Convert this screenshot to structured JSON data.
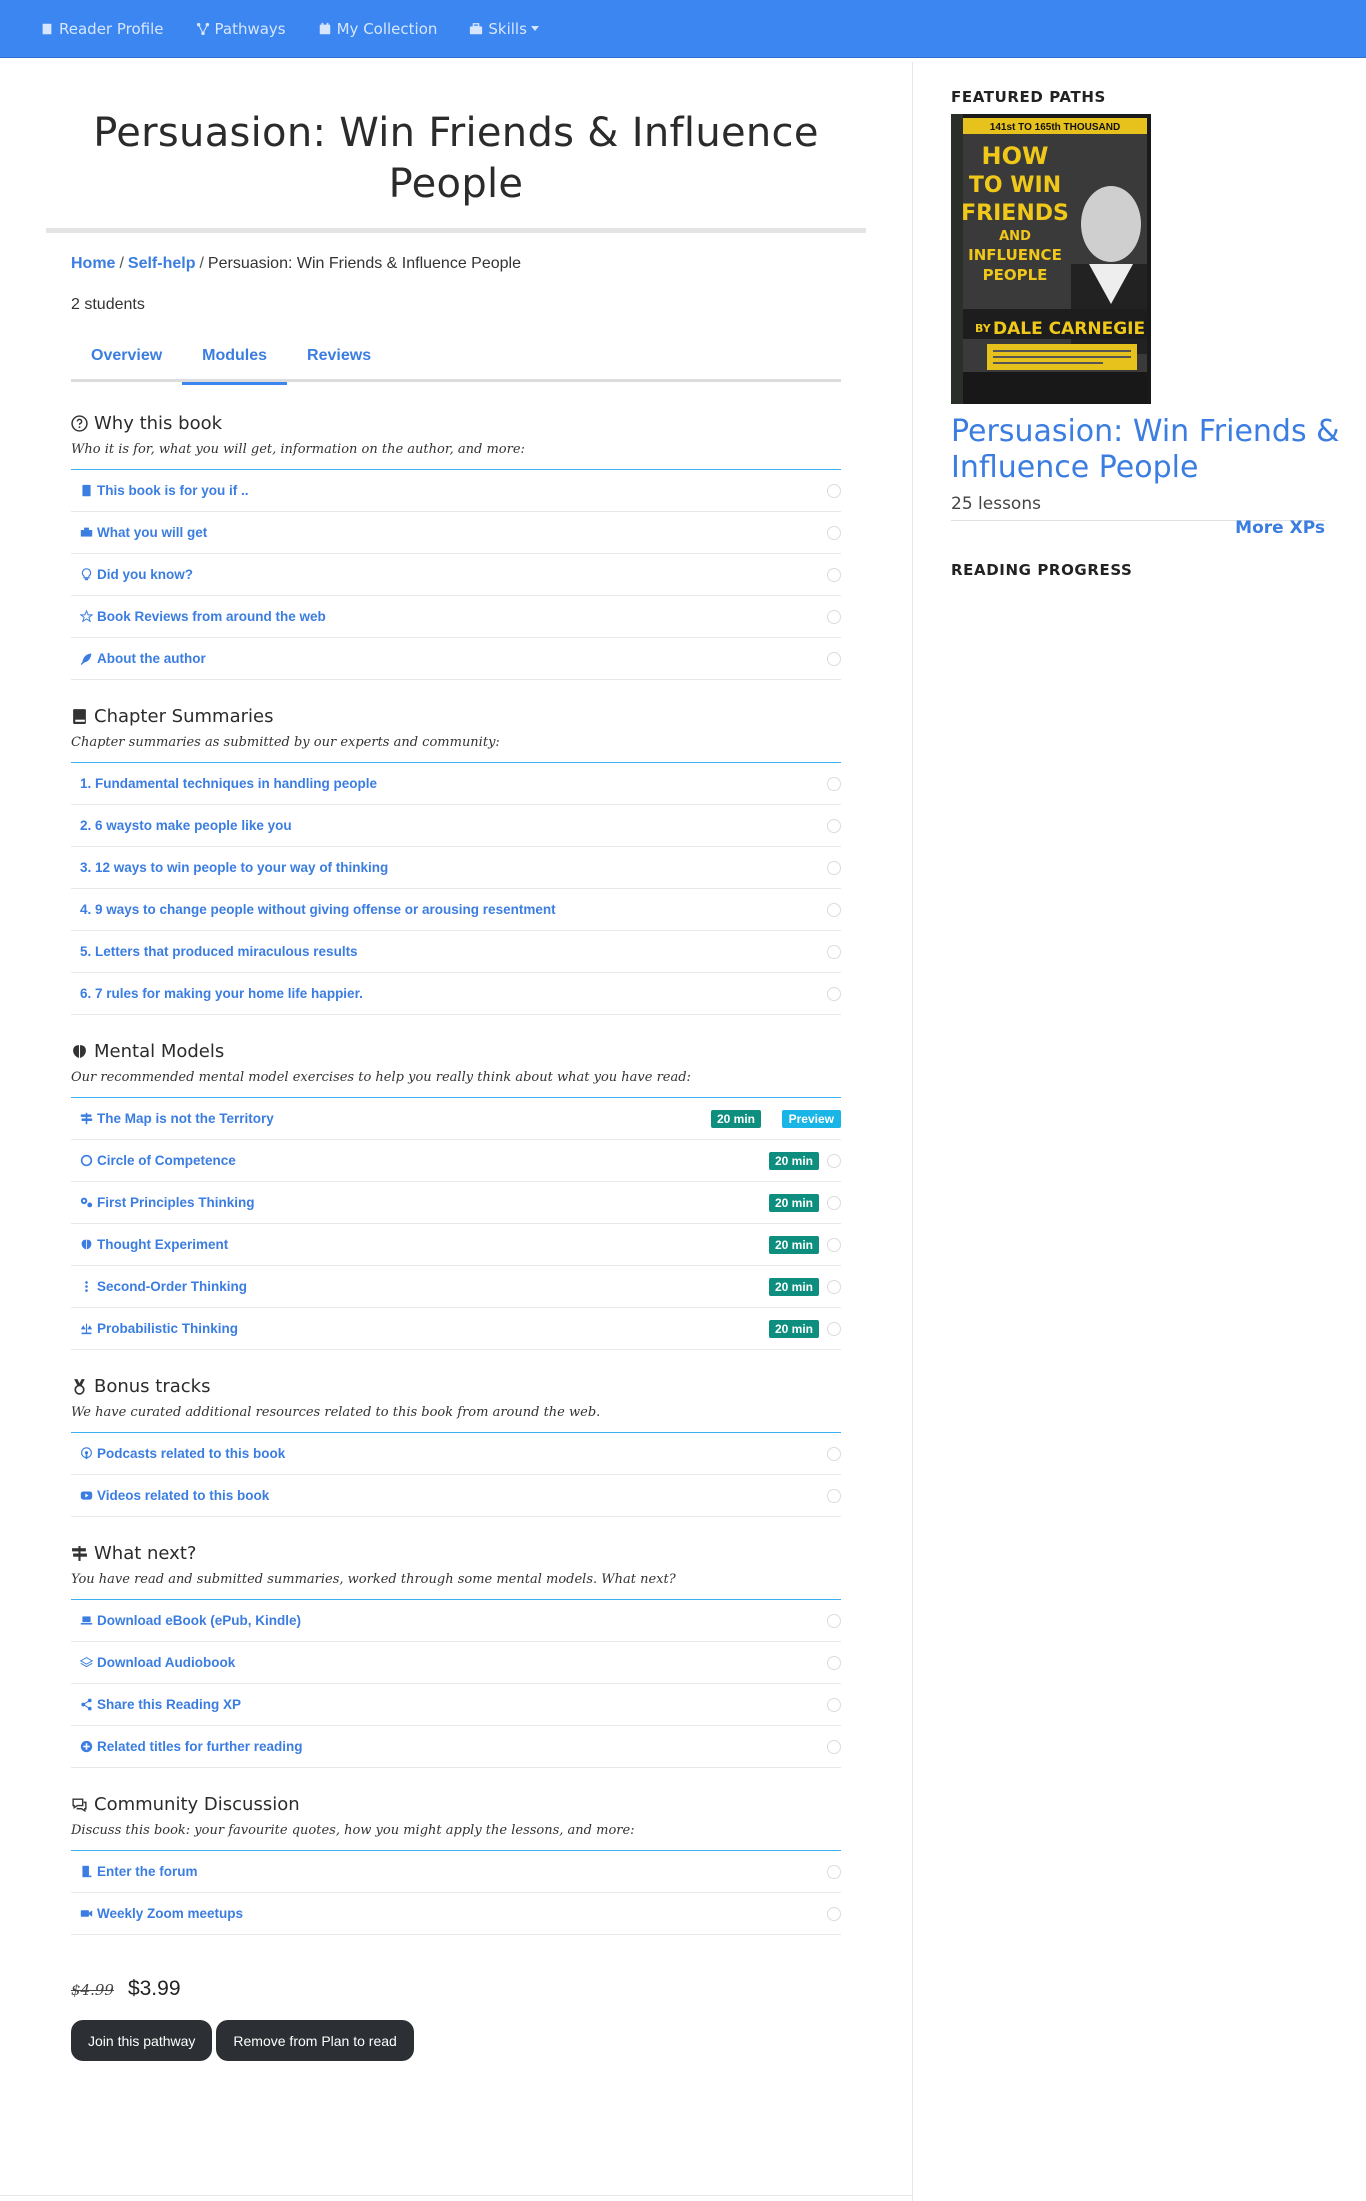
{
  "nav": {
    "items": [
      "Reader Profile",
      "Pathways",
      "My Collection",
      "Skills"
    ]
  },
  "page": {
    "title": "Persuasion: Win Friends & Influence People",
    "breadcrumb": {
      "home": "Home",
      "category": "Self-help",
      "current": "Persuasion: Win Friends & Influence People"
    },
    "students": "2 students",
    "tabs": [
      "Overview",
      "Modules",
      "Reviews"
    ],
    "active_tab": "Modules"
  },
  "sections": {
    "why": {
      "title": "Why this book",
      "desc": "Who it is for, what you will get, information on the author, and more:",
      "items": [
        "This book is for you if ..",
        "What you will get",
        "Did you know?",
        "Book Reviews from around the web",
        "About the author"
      ]
    },
    "chapters": {
      "title": "Chapter Summaries",
      "desc": "Chapter summaries as submitted by our experts and community:",
      "items": [
        "1. Fundamental techniques in handling people",
        "2. 6 waysto make people like you",
        "3. 12 ways to win people to your way of thinking",
        "4. 9 ways to change people without giving offense or arousing resentment",
        "5. Letters that produced miraculous results",
        "6. 7 rules for making your home life happier."
      ]
    },
    "models": {
      "title": "Mental Models",
      "desc": "Our recommended mental model exercises to help you really think about what you have read:",
      "items": [
        "The Map is not the Territory",
        "Circle of Competence",
        "First Principles Thinking",
        "Thought Experiment",
        "Second-Order Thinking",
        "Probabilistic Thinking"
      ],
      "duration": "20 min",
      "preview": "Preview"
    },
    "bonus": {
      "title": "Bonus tracks",
      "desc": "We have curated additional resources related to this book from around the web.",
      "items": [
        "Podcasts related to this book",
        "Videos related to this book"
      ]
    },
    "next": {
      "title": "What next?",
      "desc": "You have read and submitted summaries, worked through some mental models. What next?",
      "items": [
        "Download eBook (ePub, Kindle)",
        "Download Audiobook",
        "Share this Reading XP",
        "Related titles for further reading"
      ]
    },
    "community": {
      "title": "Community Discussion",
      "desc": "Discuss this book: your favourite quotes, how you might apply the lessons, and more:",
      "items": [
        "Enter the forum",
        "Weekly Zoom meetups"
      ]
    }
  },
  "pricing": {
    "old": "$4.99",
    "new": "$3.99"
  },
  "buttons": {
    "join": "Join this pathway",
    "remove": "Remove from Plan to read"
  },
  "sidebar": {
    "featured_heading": "FEATURED PATHS",
    "featured_title": "Persuasion: Win Friends & Influence People",
    "lessons": "25 lessons",
    "more": "More XPs",
    "progress_heading": "READING PROGRESS",
    "cover": {
      "banner": "141st TO 165th THOUSAND",
      "title_lines": [
        "HOW",
        "TO WIN",
        "FRIENDS",
        "AND",
        "INFLUENCE",
        "PEOPLE"
      ],
      "by": "BY",
      "author": "DALE CARNEGIE"
    }
  },
  "colors": {
    "nav": "#3b86f0",
    "link": "#3b7de0",
    "badge": "#0d8e7e",
    "preview": "#19b5e6",
    "button": "#2c2f33"
  }
}
